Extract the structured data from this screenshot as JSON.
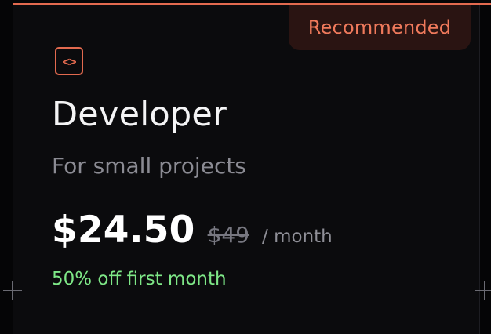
{
  "badge": {
    "label": "Recommended"
  },
  "plan": {
    "icon": "code-icon",
    "name": "Developer",
    "description": "For small projects",
    "price": "$24.50",
    "old_price": "$49",
    "period": "/ month",
    "promo": "50% off first month"
  },
  "colors": {
    "accent": "#e36a4f",
    "promo": "#7ee787",
    "text": "#f4f4f5",
    "muted": "#8b8b93"
  }
}
